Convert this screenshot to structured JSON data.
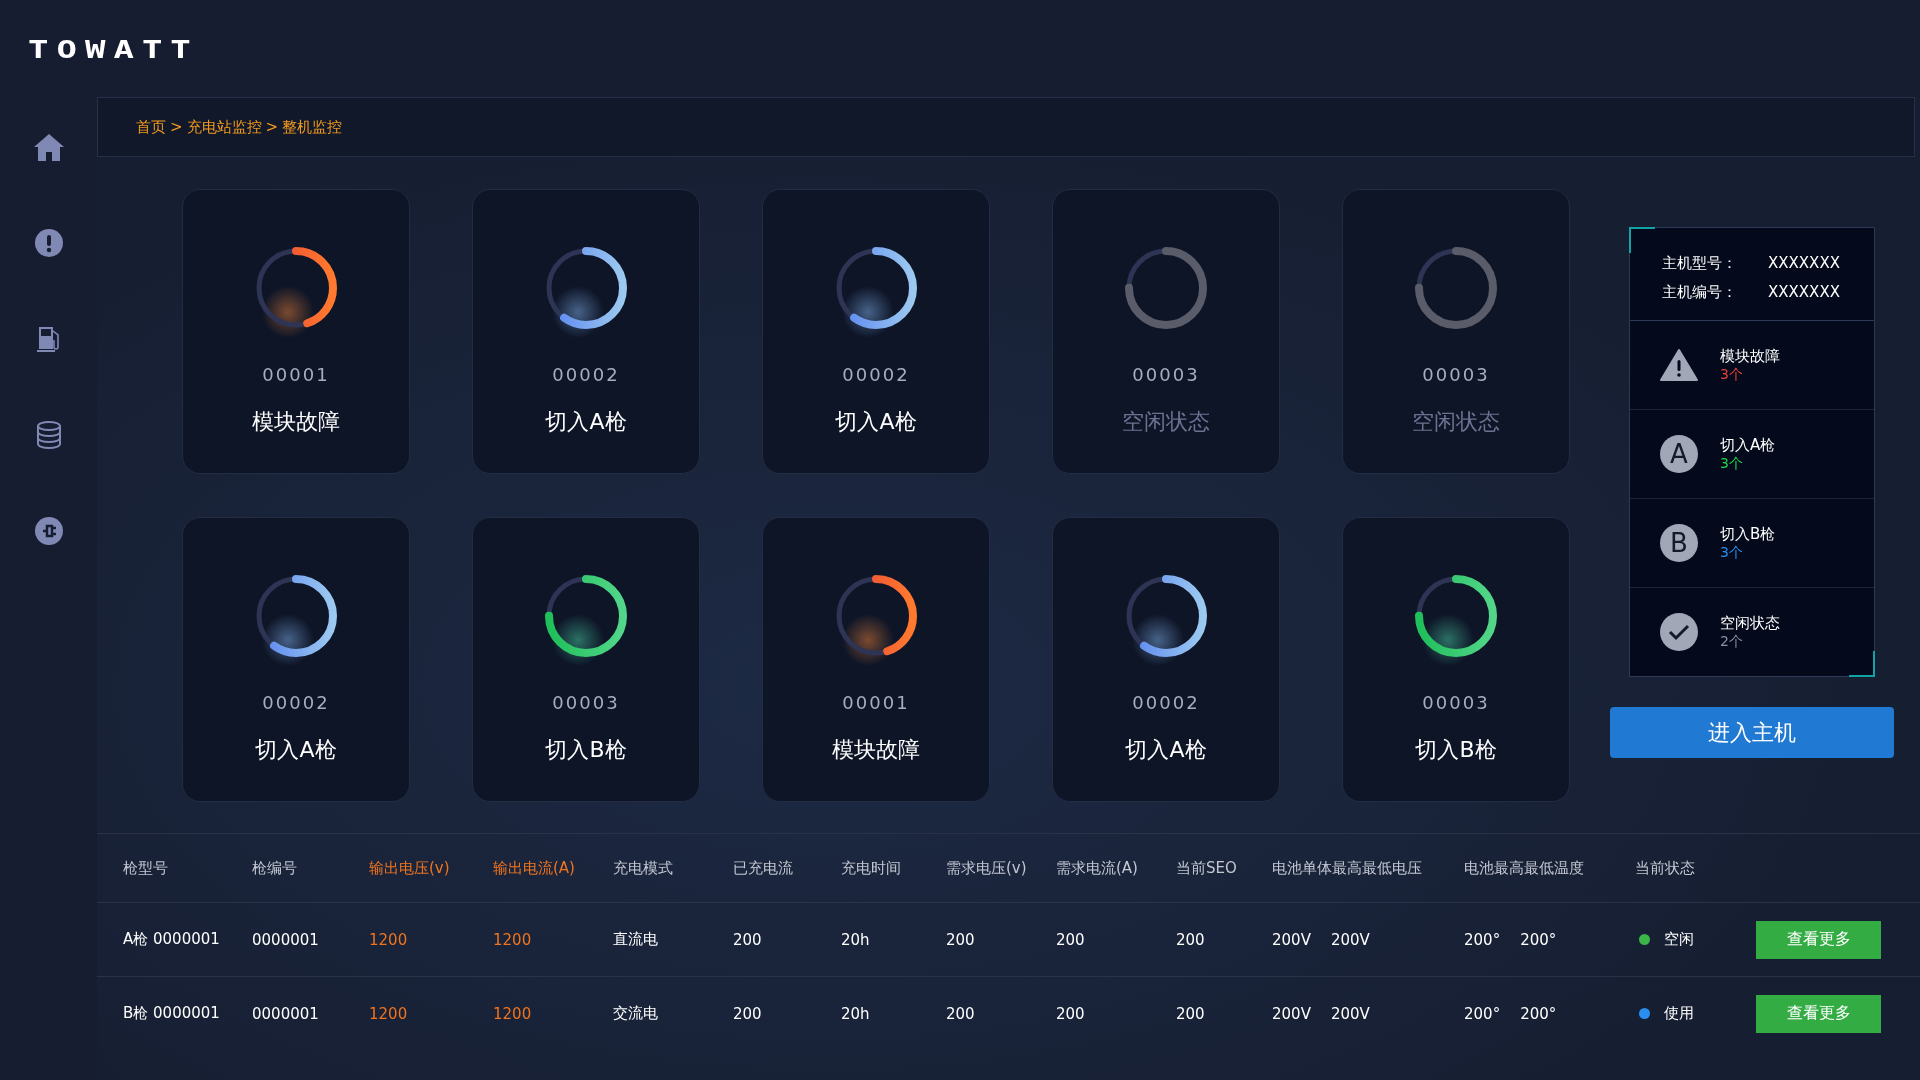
{
  "logo": "TOWATT",
  "sidebar": {
    "items": [
      {
        "kind": "home"
      },
      {
        "kind": "alert"
      },
      {
        "kind": "fuel"
      },
      {
        "kind": "database"
      },
      {
        "kind": "plug"
      }
    ]
  },
  "breadcrumb": [
    "首页",
    "充电站监控",
    "整机监控"
  ],
  "breadcrumb_separator": ">",
  "cards": [
    {
      "code": "00001",
      "label": "模块故障",
      "kind": "fault"
    },
    {
      "code": "00002",
      "label": "切入A枪",
      "kind": "gun_a"
    },
    {
      "code": "00002",
      "label": "切入A枪",
      "kind": "gun_a"
    },
    {
      "code": "00003",
      "label": "空闲状态",
      "kind": "idle"
    },
    {
      "code": "00003",
      "label": "空闲状态",
      "kind": "idle"
    },
    {
      "code": "00002",
      "label": "切入A枪",
      "kind": "gun_a"
    },
    {
      "code": "00003",
      "label": "切入B枪",
      "kind": "gun_b"
    },
    {
      "code": "00001",
      "label": "模块故障",
      "kind": "fault"
    },
    {
      "code": "00002",
      "label": "切入A枪",
      "kind": "gun_a"
    },
    {
      "code": "00003",
      "label": "切入B枪",
      "kind": "gun_b"
    }
  ],
  "host_panel": {
    "info": [
      {
        "label": "主机型号：",
        "value": "XXXXXXX"
      },
      {
        "label": "主机编号：",
        "value": "XXXXXXX"
      }
    ],
    "stats": [
      {
        "kind": "warning",
        "label": "模块故障",
        "count": "3个",
        "color": "#e8413a"
      },
      {
        "kind": "letter",
        "letter": "A",
        "label": "切入A枪",
        "count": "3个",
        "color": "#1fd84a"
      },
      {
        "kind": "letter",
        "letter": "B",
        "label": "切入B枪",
        "count": "3个",
        "color": "#2a8ef0"
      },
      {
        "kind": "check",
        "label": "空闲状态",
        "count": "2个",
        "color": "#8a8f9e"
      }
    ]
  },
  "enter_button": "进入主机",
  "table": {
    "columns": [
      {
        "label": "枪型号",
        "highlight": false
      },
      {
        "label": "枪编号",
        "highlight": false
      },
      {
        "label": "输出电压(v)",
        "highlight": true
      },
      {
        "label": "输出电流(A)",
        "highlight": true
      },
      {
        "label": "充电模式",
        "highlight": false
      },
      {
        "label": "已充电流",
        "highlight": false
      },
      {
        "label": "充电时间",
        "highlight": false
      },
      {
        "label": "需求电压(v)",
        "highlight": false
      },
      {
        "label": "需求电流(A)",
        "highlight": false
      },
      {
        "label": "当前SEO",
        "highlight": false
      },
      {
        "label": "电池单体最高最低电压",
        "highlight": false
      },
      {
        "label": "电池最高最低温度",
        "highlight": false
      },
      {
        "label": "当前状态",
        "highlight": false
      }
    ],
    "rows": [
      {
        "cells": [
          [
            "A枪 0000001"
          ],
          [
            "0000001"
          ],
          [
            "1200"
          ],
          [
            "1200"
          ],
          [
            "直流电"
          ],
          [
            "200"
          ],
          [
            "20h"
          ],
          [
            "200"
          ],
          [
            "200"
          ],
          [
            "200"
          ],
          [
            "200V",
            "200V"
          ],
          [
            "200°",
            "200°"
          ]
        ],
        "status": {
          "label": "空闲",
          "color": "#3cb44a"
        },
        "action": "查看更多"
      },
      {
        "cells": [
          [
            "B枪 0000001"
          ],
          [
            "0000001"
          ],
          [
            "1200"
          ],
          [
            "1200"
          ],
          [
            "交流电"
          ],
          [
            "200"
          ],
          [
            "20h"
          ],
          [
            "200"
          ],
          [
            "200"
          ],
          [
            "200"
          ],
          [
            "200V",
            "200V"
          ],
          [
            "200°",
            "200°"
          ]
        ],
        "status": {
          "label": "使用",
          "color": "#2a8ef0"
        },
        "action": "查看更多"
      }
    ]
  }
}
